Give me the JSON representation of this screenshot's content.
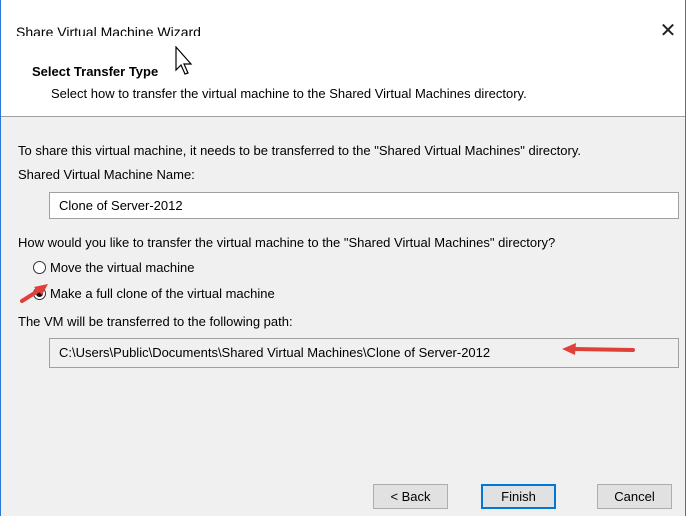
{
  "window": {
    "title": "Share Virtual Machine Wizard",
    "close_glyph": "✕"
  },
  "header": {
    "title": "Select Transfer Type",
    "subtitle": "Select how to transfer the virtual machine to the Shared Virtual Machines directory."
  },
  "form": {
    "intro": "To share this virtual machine, it needs to be transferred to the \"Shared Virtual Machines\" directory.",
    "name_label": "Shared Virtual Machine Name:",
    "name_value": "Clone of Server-2012",
    "transfer_question": "How would you like to transfer the virtual machine to the \"Shared Virtual Machines\" directory?",
    "options": [
      {
        "label": "Move the virtual machine",
        "checked": false
      },
      {
        "label": "Make a full clone of the virtual machine",
        "checked": true
      }
    ],
    "path_label": "The VM will be transferred to the following path:",
    "path_value": "C:\\Users\\Public\\Documents\\Shared Virtual Machines\\Clone of Server-2012"
  },
  "footer": {
    "back_label": "< Back",
    "finish_label": "Finish",
    "cancel_label": "Cancel"
  },
  "colors": {
    "annotation_arrow": "#e0403a",
    "window_border": "#2b78d8",
    "default_button": "#0078d7"
  },
  "icons": [
    "close-icon",
    "mouse-pointer-icon",
    "annotation-arrow-icon"
  ]
}
